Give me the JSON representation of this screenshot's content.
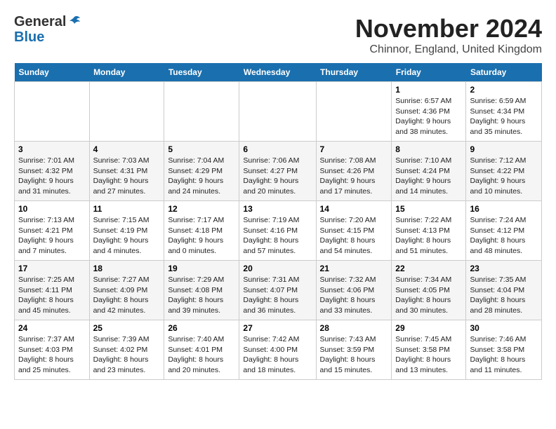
{
  "header": {
    "logo_line1": "General",
    "logo_line2": "Blue",
    "month_title": "November 2024",
    "location": "Chinnor, England, United Kingdom"
  },
  "weekdays": [
    "Sunday",
    "Monday",
    "Tuesday",
    "Wednesday",
    "Thursday",
    "Friday",
    "Saturday"
  ],
  "weeks": [
    [
      {
        "day": "",
        "info": ""
      },
      {
        "day": "",
        "info": ""
      },
      {
        "day": "",
        "info": ""
      },
      {
        "day": "",
        "info": ""
      },
      {
        "day": "",
        "info": ""
      },
      {
        "day": "1",
        "info": "Sunrise: 6:57 AM\nSunset: 4:36 PM\nDaylight: 9 hours and 38 minutes."
      },
      {
        "day": "2",
        "info": "Sunrise: 6:59 AM\nSunset: 4:34 PM\nDaylight: 9 hours and 35 minutes."
      }
    ],
    [
      {
        "day": "3",
        "info": "Sunrise: 7:01 AM\nSunset: 4:32 PM\nDaylight: 9 hours and 31 minutes."
      },
      {
        "day": "4",
        "info": "Sunrise: 7:03 AM\nSunset: 4:31 PM\nDaylight: 9 hours and 27 minutes."
      },
      {
        "day": "5",
        "info": "Sunrise: 7:04 AM\nSunset: 4:29 PM\nDaylight: 9 hours and 24 minutes."
      },
      {
        "day": "6",
        "info": "Sunrise: 7:06 AM\nSunset: 4:27 PM\nDaylight: 9 hours and 20 minutes."
      },
      {
        "day": "7",
        "info": "Sunrise: 7:08 AM\nSunset: 4:26 PM\nDaylight: 9 hours and 17 minutes."
      },
      {
        "day": "8",
        "info": "Sunrise: 7:10 AM\nSunset: 4:24 PM\nDaylight: 9 hours and 14 minutes."
      },
      {
        "day": "9",
        "info": "Sunrise: 7:12 AM\nSunset: 4:22 PM\nDaylight: 9 hours and 10 minutes."
      }
    ],
    [
      {
        "day": "10",
        "info": "Sunrise: 7:13 AM\nSunset: 4:21 PM\nDaylight: 9 hours and 7 minutes."
      },
      {
        "day": "11",
        "info": "Sunrise: 7:15 AM\nSunset: 4:19 PM\nDaylight: 9 hours and 4 minutes."
      },
      {
        "day": "12",
        "info": "Sunrise: 7:17 AM\nSunset: 4:18 PM\nDaylight: 9 hours and 0 minutes."
      },
      {
        "day": "13",
        "info": "Sunrise: 7:19 AM\nSunset: 4:16 PM\nDaylight: 8 hours and 57 minutes."
      },
      {
        "day": "14",
        "info": "Sunrise: 7:20 AM\nSunset: 4:15 PM\nDaylight: 8 hours and 54 minutes."
      },
      {
        "day": "15",
        "info": "Sunrise: 7:22 AM\nSunset: 4:13 PM\nDaylight: 8 hours and 51 minutes."
      },
      {
        "day": "16",
        "info": "Sunrise: 7:24 AM\nSunset: 4:12 PM\nDaylight: 8 hours and 48 minutes."
      }
    ],
    [
      {
        "day": "17",
        "info": "Sunrise: 7:25 AM\nSunset: 4:11 PM\nDaylight: 8 hours and 45 minutes."
      },
      {
        "day": "18",
        "info": "Sunrise: 7:27 AM\nSunset: 4:09 PM\nDaylight: 8 hours and 42 minutes."
      },
      {
        "day": "19",
        "info": "Sunrise: 7:29 AM\nSunset: 4:08 PM\nDaylight: 8 hours and 39 minutes."
      },
      {
        "day": "20",
        "info": "Sunrise: 7:31 AM\nSunset: 4:07 PM\nDaylight: 8 hours and 36 minutes."
      },
      {
        "day": "21",
        "info": "Sunrise: 7:32 AM\nSunset: 4:06 PM\nDaylight: 8 hours and 33 minutes."
      },
      {
        "day": "22",
        "info": "Sunrise: 7:34 AM\nSunset: 4:05 PM\nDaylight: 8 hours and 30 minutes."
      },
      {
        "day": "23",
        "info": "Sunrise: 7:35 AM\nSunset: 4:04 PM\nDaylight: 8 hours and 28 minutes."
      }
    ],
    [
      {
        "day": "24",
        "info": "Sunrise: 7:37 AM\nSunset: 4:03 PM\nDaylight: 8 hours and 25 minutes."
      },
      {
        "day": "25",
        "info": "Sunrise: 7:39 AM\nSunset: 4:02 PM\nDaylight: 8 hours and 23 minutes."
      },
      {
        "day": "26",
        "info": "Sunrise: 7:40 AM\nSunset: 4:01 PM\nDaylight: 8 hours and 20 minutes."
      },
      {
        "day": "27",
        "info": "Sunrise: 7:42 AM\nSunset: 4:00 PM\nDaylight: 8 hours and 18 minutes."
      },
      {
        "day": "28",
        "info": "Sunrise: 7:43 AM\nSunset: 3:59 PM\nDaylight: 8 hours and 15 minutes."
      },
      {
        "day": "29",
        "info": "Sunrise: 7:45 AM\nSunset: 3:58 PM\nDaylight: 8 hours and 13 minutes."
      },
      {
        "day": "30",
        "info": "Sunrise: 7:46 AM\nSunset: 3:58 PM\nDaylight: 8 hours and 11 minutes."
      }
    ]
  ]
}
